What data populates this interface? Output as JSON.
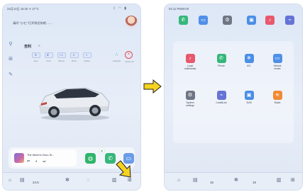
{
  "left_screen": {
    "status": {
      "time_info": "22月13日 16:40  ☀ 27°C"
    },
    "greeting": "请问 “小七” 打开附近的吧……",
    "car_label": "吉利",
    "car_label_chevron": "»",
    "controls": [
      {
        "name": "light",
        "label": "Auto"
      },
      {
        "name": "fog",
        "label": "Front"
      },
      {
        "name": "seat",
        "label": "Defrost"
      },
      {
        "name": "view",
        "label": "Mirror"
      },
      {
        "name": "fold",
        "label": "Follow"
      }
    ],
    "parking_label": "Autopark",
    "power_label": "Power off",
    "music": {
      "title": "The World in Euro Sr..."
    },
    "dock": {
      "temp_left": "24.5",
      "temp_right": "22"
    }
  },
  "right_screen": {
    "status": {
      "time_info": "02:11  PM00:00"
    },
    "apps": [
      {
        "name": "Local multimedia",
        "label": "Local\nmultimedia",
        "color": "#e8586d",
        "icon": "♪"
      },
      {
        "name": "Phone",
        "label": "Phone",
        "color": "#35b77a",
        "icon": "✆"
      },
      {
        "name": "A/C",
        "label": "A/C",
        "color": "#4a8ee6",
        "icon": "❄"
      },
      {
        "name": "Vehicle center",
        "label": "Vehicle\ncenter",
        "color": "#4f8fe8",
        "icon": "▭"
      },
      {
        "name": "System settings",
        "label": "System\nsettings",
        "color": "#6f7686",
        "icon": "⚙"
      },
      {
        "name": "CarbitLink",
        "label": "CarbitLink",
        "color": "#6673d6",
        "icon": "⌁"
      },
      {
        "name": "AVM",
        "label": "AVM",
        "color": "#4a8ee6",
        "icon": "▣"
      },
      {
        "name": "Radio",
        "label": "Radio",
        "color": "#f08a33",
        "icon": "≋"
      }
    ],
    "top_app_colors": [
      "#35b77a",
      "#4f8fe8",
      "#6f7686",
      "#4a8ee6",
      "#e8586d",
      "#6673d6"
    ],
    "dock": {
      "temp_left": "16",
      "temp_right": "16"
    }
  },
  "colors": {
    "arrow": "#f5d21f",
    "arrow_outline": "#222222",
    "power_red": "#e5484d",
    "park_green": "#2fb58a"
  }
}
